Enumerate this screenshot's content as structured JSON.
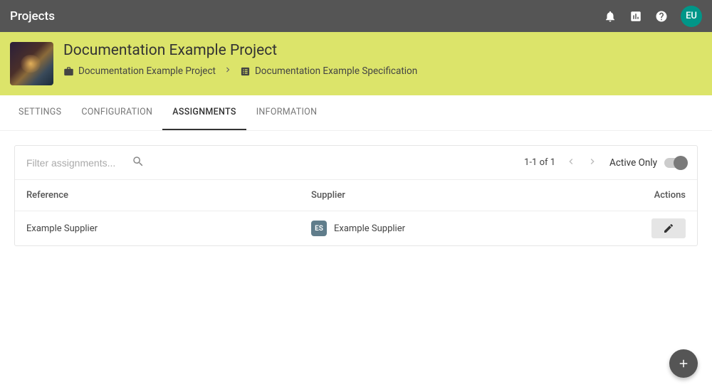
{
  "topbar": {
    "title": "Projects",
    "avatar_initials": "EU"
  },
  "header": {
    "project_title": "Documentation Example Project",
    "breadcrumb": {
      "item1_label": "Documentation Example Project",
      "item2_label": "Documentation Example Specification"
    }
  },
  "tabs": {
    "settings": "SETTINGS",
    "configuration": "CONFIGURATION",
    "assignments": "ASSIGNMENTS",
    "information": "INFORMATION",
    "active": "assignments"
  },
  "toolbar": {
    "filter_placeholder": "Filter assignments...",
    "pagination_label": "1-1 of 1",
    "active_only_label": "Active Only"
  },
  "table": {
    "headers": {
      "reference": "Reference",
      "supplier": "Supplier",
      "actions": "Actions"
    },
    "rows": [
      {
        "reference": "Example Supplier",
        "supplier_badge": "ES",
        "supplier_name": "Example Supplier"
      }
    ]
  },
  "colors": {
    "banner_bg": "#dce46a",
    "avatar_bg": "#009688",
    "supplier_badge_bg": "#607d8b",
    "fab_bg": "#555555"
  }
}
